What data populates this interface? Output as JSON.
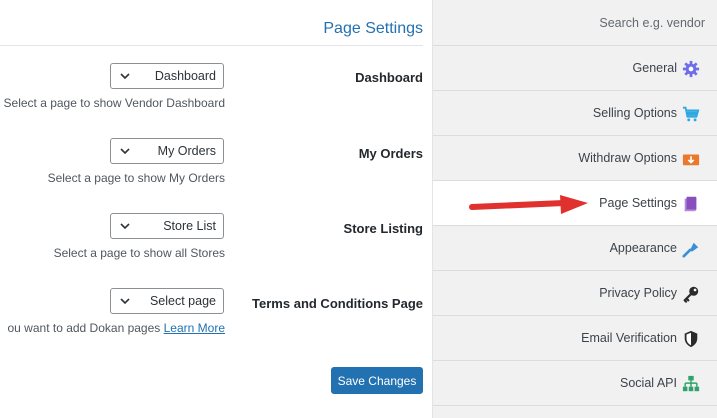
{
  "main": {
    "title": "Page Settings",
    "settings": [
      {
        "label": "Dashboard",
        "selected": "Dashboard",
        "description": "Select a page to show Vendor Dashboard"
      },
      {
        "label": "My Orders",
        "selected": "My Orders",
        "description": "Select a page to show My Orders"
      },
      {
        "label": "Store Listing",
        "selected": "Store List",
        "description": "Select a page to show all Stores"
      },
      {
        "label": "Terms and Conditions Page",
        "selected": "Select page",
        "description": "ou want to add Dokan pages",
        "link": "Learn More"
      }
    ],
    "save_label": "Save Changes"
  },
  "sidebar": {
    "search_placeholder": "Search e.g. vendor",
    "items": [
      {
        "label": "General",
        "icon": "gear-icon",
        "color": "#6f6ee8"
      },
      {
        "label": "Selling Options",
        "icon": "cart-icon",
        "color": "#2da8e0"
      },
      {
        "label": "Withdraw Options",
        "icon": "withdraw-icon",
        "color": "#e8792d"
      },
      {
        "label": "Page Settings",
        "icon": "page-icon",
        "color": "#8a4fbf"
      },
      {
        "label": "Appearance",
        "icon": "appearance-icon",
        "color": "#3a8fd6"
      },
      {
        "label": "Privacy Policy",
        "icon": "key-icon",
        "color": "#2b2b2b"
      },
      {
        "label": "Email Verification",
        "icon": "shield-icon",
        "color": "#2b2b2b"
      },
      {
        "label": "Social API",
        "icon": "sitemap-icon",
        "color": "#2fa36b"
      }
    ],
    "active_index": 3
  },
  "annotation": {
    "arrow_color": "#e0312f"
  }
}
